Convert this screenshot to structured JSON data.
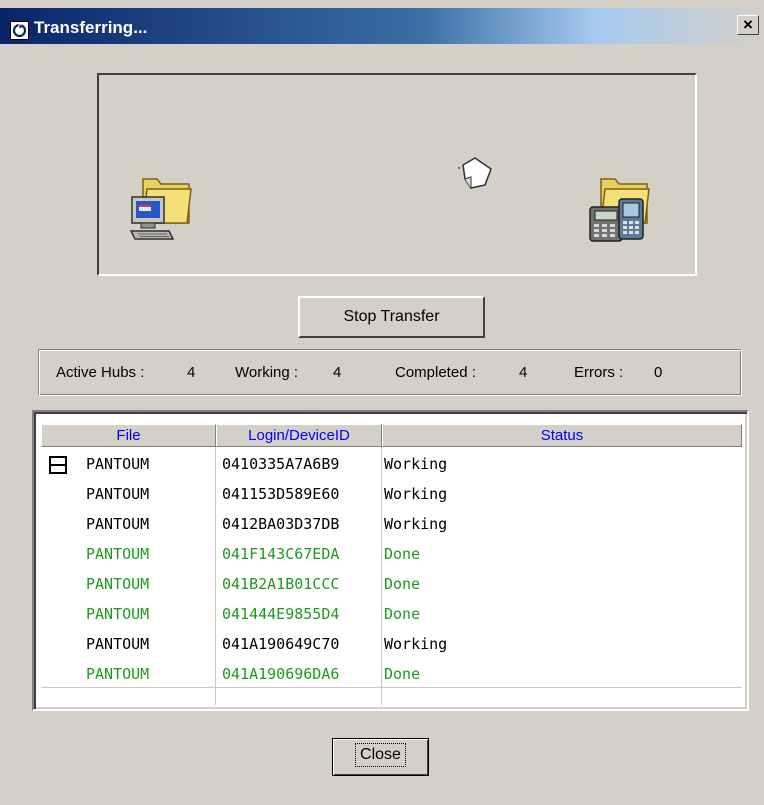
{
  "window": {
    "title": "Transferring...",
    "close_glyph": "×"
  },
  "buttons": {
    "stop_label": "Stop Transfer",
    "close_label": "Close"
  },
  "stats": {
    "active_hubs_label": "Active Hubs :",
    "active_hubs_value": "4",
    "working_label": "Working :",
    "working_value": "4",
    "completed_label": "Completed :",
    "completed_value": "4",
    "errors_label": "Errors :",
    "errors_value": "0"
  },
  "table": {
    "columns": [
      "File",
      "Login/DeviceID",
      "Status"
    ],
    "rows": [
      {
        "file": "PANTOUM",
        "device": "0410335A7A6B9",
        "status": "Working",
        "color": "#000000"
      },
      {
        "file": "PANTOUM",
        "device": "041153D589E60",
        "status": "Working",
        "color": "#000000"
      },
      {
        "file": "PANTOUM",
        "device": "0412BA03D37DB",
        "status": "Working",
        "color": "#000000"
      },
      {
        "file": "PANTOUM",
        "device": "041F143C67EDA",
        "status": "Done",
        "color": "#1f9a1f"
      },
      {
        "file": "PANTOUM",
        "device": "041B2A1B01CCC",
        "status": "Done",
        "color": "#1f9a1f"
      },
      {
        "file": "PANTOUM",
        "device": "041444E9855D4",
        "status": "Done",
        "color": "#1f9a1f"
      },
      {
        "file": "PANTOUM",
        "device": "041A190649C70",
        "status": "Working",
        "color": "#000000"
      },
      {
        "file": "PANTOUM",
        "device": "041A190696DA6",
        "status": "Done",
        "color": "#1f9a1f"
      }
    ]
  },
  "icons": {
    "title": "app-icon",
    "source": "computer-folder-icon",
    "transfer": "paper-icon",
    "target": "handheld-folder-icon",
    "tree": "collapse-box-icon"
  },
  "colors": {
    "header_text": "#0000ff",
    "done": "#1f9a1f",
    "working": "#000000"
  }
}
